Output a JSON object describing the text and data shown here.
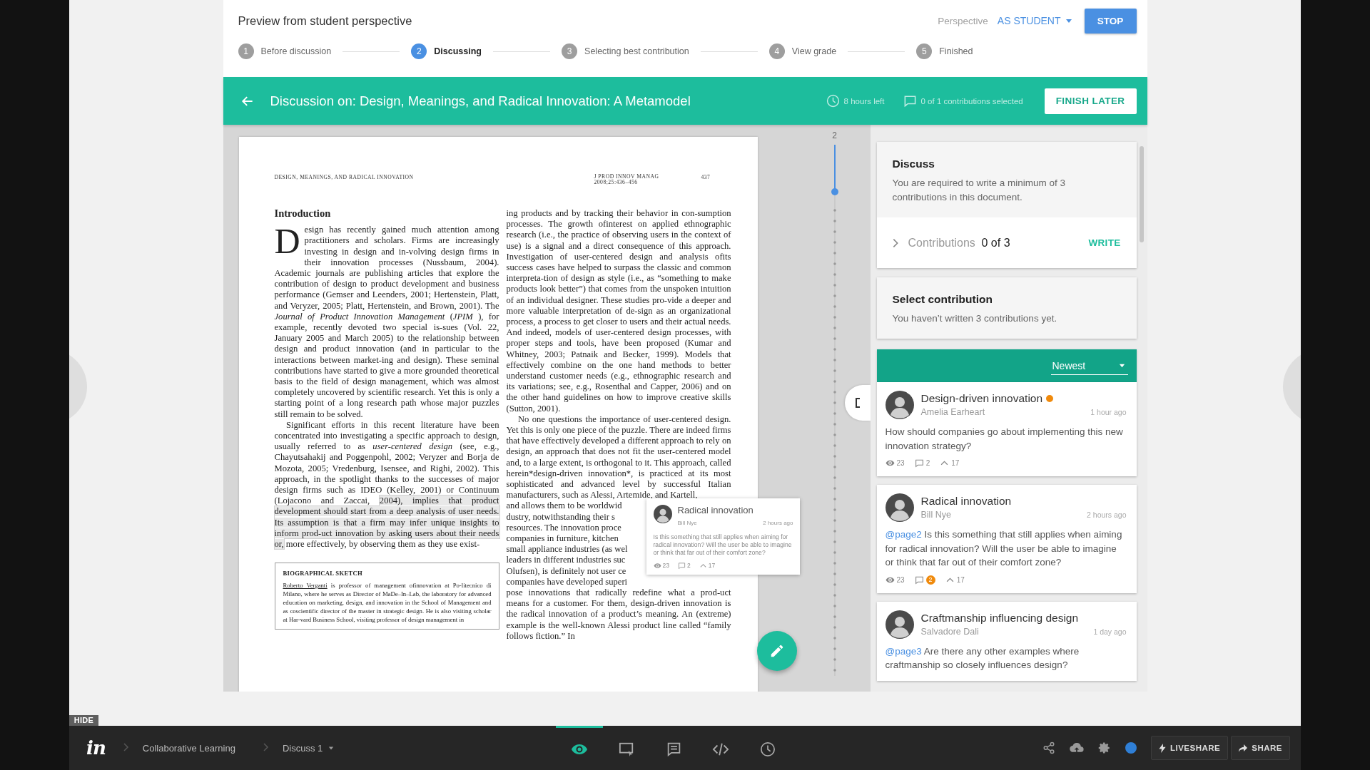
{
  "header": {
    "title": "Preview from student perspective",
    "perspective_label": "Perspective",
    "perspective_value": "AS STUDENT",
    "stop_button": "STOP"
  },
  "steps": [
    {
      "number": "1",
      "label": "Before discussion",
      "selected": false
    },
    {
      "number": "2",
      "label": "Discussing",
      "selected": true
    },
    {
      "number": "3",
      "label": "Selecting best contribution",
      "selected": false
    },
    {
      "number": "4",
      "label": "View grade",
      "selected": false
    },
    {
      "number": "5",
      "label": "Finished",
      "selected": false
    }
  ],
  "discussion_bar": {
    "title": "Discussion on: Design, Meanings, and Radical Innovation: A Metamodel",
    "time_left": "8 hours left",
    "contributions_selected": "0 of 1 contributions selected",
    "finish_button": "FINISH LATER"
  },
  "document": {
    "running_head": "DESIGN, MEANINGS, AND RADICAL INNOVATION",
    "journal": "J PROD INNOV MANAG",
    "journal_issue": "2008;25:436–456",
    "page_number": "437",
    "heading": "Introduction",
    "drop_cap": "D",
    "intro_paragraph": "esign has recently gained much attention among practitioners and scholars. Firms are increasingly investing in design and in-volving design firms in their innovation processes (Nussbaum, 2004). Academic journals are publishing articles that explore the contribution of design to product development and business performance (Gemser and Leenders, 2001; Hertenstein, Platt, and Veryzer, 2005; Platt, Hertenstein, and Brown, 2001). The *Journal of Product Innovation Management* (*JPIM* ), for example, recently devoted two special is-sues (Vol. 22, January 2005 and March 2005) to the relationship between design and product innovation (and in particular to the interactions between market-ing and design). These seminal contributions have started to give a more grounded theoretical basis to the field of design management, which was almost completely uncovered by scientific research. Yet this is only a starting point of a long research path whose major puzzles still remain to be solved.",
    "second_paragraph": [
      {
        "text": "Significant efforts in this recent literature have been concentrated into investigating a specific approach to design, usually referred to as *user-centered design* (see, e.g., Chayutsahakij and Poggenpohl, 2002; Veryzer and Borja de Mozota, 2005; Vredenburg, Isensee, and Righi, 2002). This approach, in the spotlight thanks to the successes of major design firms such as IDEO (Kelley, 2001) or Continuum (Lojacono and Zaccai, ",
        "highlighted": false
      },
      {
        "text": "2004), implies that product development should start from a deep analysis of user needs. Its assumption is that a firm may infer unique insights to inform prod-uct innovation by asking users about their needs or,",
        "highlighted": true
      },
      {
        "text": " more effectively, by observing them as they use exist-",
        "highlighted": false
      }
    ],
    "bio": {
      "title": "BIOGRAPHICAL SKETCH",
      "name_link": "Roberto Verganti",
      "text": " is professor of management ofinnovation at Po-litecnico di Milano, where he serves as Director of MaDe–In–Lab, the laboratory for advanced education on marketing, design, and innovation in the School of Management and as coscientific director of the master in strategic design. He is also visiting scholar at Har-vard Business School, visiting professor of design management in"
    },
    "right_paragraph": "ing products and by tracking their behavior in con-sumption processes. The growth ofinterest on applied ethnographic research (i.e., the practice of observing users in the context of use) is a signal and a direct consequence of this approach. Investigation of user-centered design and analysis ofits success cases have helped to surpass the classic and common interpreta-tion of design as style (i.e., as “something to make products look better”) that comes from the unspoken intuition of an individual designer. These studies pro-vide a deeper and more valuable interpretation of de-sign as an organizational process, a process to get closer to users and their actual needs. And indeed, models of user-centered design processes, with proper steps and tools, have been proposed (Kumar and Whitney, 2003; Patnaik and Becker, 1999). Models that effectively combine on the one hand methods to better understand customer needs (e.g., ethnographic research and its variations; see, e.g., Rosenthal and Capper, 2006) and on the other hand guidelines on how to improve creative skills (Sutton, 2001).",
    "right_paragraph_2": "No one questions the importance of user-centered design. Yet this is only one piece of the puzzle. There are indeed firms that have effectively developed a different approach to rely on design, an approach that does not fit the user-centered model and, to a large extent, is orthogonal to it. This approach, called herein*design-driven innovation*, is practiced at its most sophisticated and advanced level by successful Italian manufacturers, such as Alessi, Artemide, and Kartell,",
    "covered_lines": [
      "and allows them to be worldwid",
      "dustry, notwithstanding their s",
      "resources. The innovation proce",
      "companies in furniture, kitchen",
      "small appliance industries (as wel",
      "leaders in different industries suc",
      "Olufsen), is definitely not user ce",
      "companies have developed superi"
    ],
    "right_paragraph_3": "pose innovations that radically redefine what a prod-uct means for a customer. For them, design-driven innovation is the radical innovation of a product’s meaning. An (extreme) example is the well-known Alessi product line called “family follows fiction.” In"
  },
  "timeline": {
    "page_number": "2"
  },
  "popup_comment": {
    "title": "Radical innovation",
    "author": "Bill Nye",
    "time": "2 hours ago",
    "text": "Is this something that still applies when aiming for radical innovation? Will the user be able to imagine or think that far out of their comfort zone?",
    "views": "23",
    "replies": "2",
    "upvotes": "17"
  },
  "panel": {
    "discuss": {
      "title": "Discuss",
      "text": "You are required to write a minimum of 3 contributions in this document.",
      "contributions_label": "Contributions",
      "contributions_count": "0 of 3",
      "expanded": false,
      "write_button": "WRITE"
    },
    "select": {
      "title": "Select contribution",
      "text": "You haven’t written 3 contributions yet."
    },
    "sort": "Newest",
    "comments": [
      {
        "title": "Design-driven innovation",
        "unread": true,
        "author": "Amelia Earheart",
        "time": "1 hour ago",
        "text": "How should companies go about implementing this new innovation strategy?",
        "views": "23",
        "replies": "2",
        "new_replies": false,
        "upvotes": "17"
      },
      {
        "title": "Radical innovation",
        "unread": false,
        "author": "Bill Nye",
        "time": "2 hours ago",
        "mention": "@page2",
        "text": "Is this something that still applies when aiming for radical innovation? Will the user be able to imagine or think that far out of their comfort zone?",
        "views": "23",
        "replies": "2",
        "new_replies": true,
        "upvotes": "17"
      },
      {
        "title": "Craftmanship influencing design",
        "unread": false,
        "author": "Salvadore Dali",
        "time": "1 day ago",
        "mention": "@page3",
        "text": "Are there any other examples where craftmanship so closely influences design?"
      }
    ]
  },
  "toolbar": {
    "hide": "HIDE",
    "logo": "in",
    "breadcrumbs": [
      "Collaborative Learning",
      "Discuss 1"
    ],
    "modes": [
      {
        "kind": "preview",
        "selected": true
      },
      {
        "kind": "inspect",
        "selected": false
      },
      {
        "kind": "comments",
        "selected": false
      },
      {
        "kind": "code",
        "selected": false
      },
      {
        "kind": "history",
        "selected": false
      }
    ],
    "liveshare": "LIVESHARE",
    "share": "SHARE"
  }
}
